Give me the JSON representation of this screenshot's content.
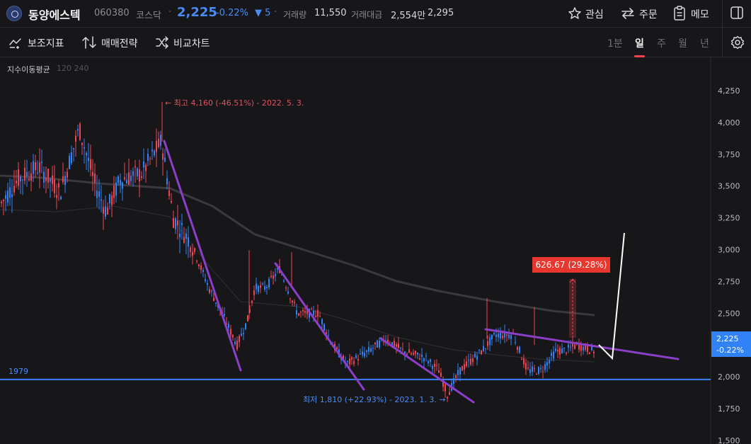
{
  "header": {
    "name": "동양에스텍",
    "code": "060380",
    "market": "코스닥",
    "dot": "·",
    "price": "2,225",
    "change_pct": "-0.22%",
    "change_abs": "▼ 5",
    "volume_label": "거래량",
    "volume": "11,550",
    "amount_label": "거래대금",
    "amount": "2,554만",
    "extra": "2,295",
    "watch_label": "관심",
    "order_label": "주문",
    "memo_label": "메모"
  },
  "toolbar": {
    "indicator_label": "보조지표",
    "strategy_label": "매매전략",
    "compare_label": "비교차트",
    "periods": [
      "1분",
      "일",
      "주",
      "월",
      "년"
    ],
    "active_period": "일"
  },
  "chart_data": {
    "type": "candlestick",
    "ma_legend": "지수이동평균",
    "ma_periods": "120 240",
    "y_ticks": [
      "4,250",
      "4,000",
      "3,750",
      "3,500",
      "3,250",
      "3,000",
      "2,750",
      "2,500",
      "2,250",
      "2,000",
      "1,750",
      "1,500"
    ],
    "ylim": [
      1500,
      4250
    ],
    "current_price_label": "2,225",
    "current_change_label": "-0.22%",
    "support_level": 1979,
    "support_label": "1979",
    "high_annotation": "← 최고 4,160 (-46.51%) - 2022. 5. 3.",
    "low_annotation": "최저 1,810 (+22.93%) - 2023. 1. 3. →",
    "measure_label": "626.67  (29.28%)",
    "colors": {
      "up": "#f04452",
      "down": "#3182f6",
      "trendline": "#8b3fc9",
      "support": "#3b82f6",
      "ma": "#3a3a3e"
    }
  }
}
